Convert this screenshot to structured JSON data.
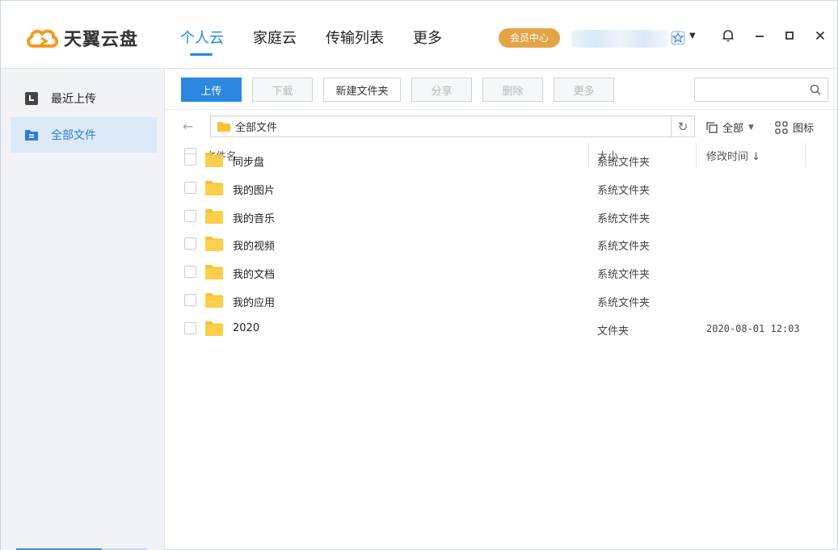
{
  "app": {
    "name": "天翼云盘"
  },
  "nav": {
    "items": [
      "个人云",
      "家庭云",
      "传输列表",
      "更多"
    ],
    "active_index": 0
  },
  "header": {
    "vip_label": "会员中心"
  },
  "sidebar": {
    "items": [
      {
        "label": "最近上传",
        "icon": "recent-upload-icon"
      },
      {
        "label": "全部文件",
        "icon": "all-files-icon"
      }
    ],
    "active_index": 1
  },
  "toolbar": {
    "upload": "上传",
    "download": "下载",
    "new_folder": "新建文件夹",
    "share": "分享",
    "delete": "删除",
    "more": "更多",
    "search_placeholder": ""
  },
  "path": {
    "current": "全部文件"
  },
  "filter": {
    "label": "全部"
  },
  "view": {
    "label": "图标"
  },
  "list": {
    "columns": {
      "name": "文件名",
      "size": "大小",
      "time": "修改时间 ↓"
    },
    "rows": [
      {
        "name": "同步盘",
        "type": "系统文件夹",
        "time": ""
      },
      {
        "name": "我的图片",
        "type": "系统文件夹",
        "time": ""
      },
      {
        "name": "我的音乐",
        "type": "系统文件夹",
        "time": ""
      },
      {
        "name": "我的视频",
        "type": "系统文件夹",
        "time": ""
      },
      {
        "name": "我的文档",
        "type": "系统文件夹",
        "time": ""
      },
      {
        "name": "我的应用",
        "type": "系统文件夹",
        "time": ""
      },
      {
        "name": "2020",
        "type": "文件夹",
        "time": "2020-08-01 12:03"
      }
    ]
  },
  "colors": {
    "accent": "#2b87e0",
    "vip": "#e4a445",
    "folder": "#f7c236"
  }
}
